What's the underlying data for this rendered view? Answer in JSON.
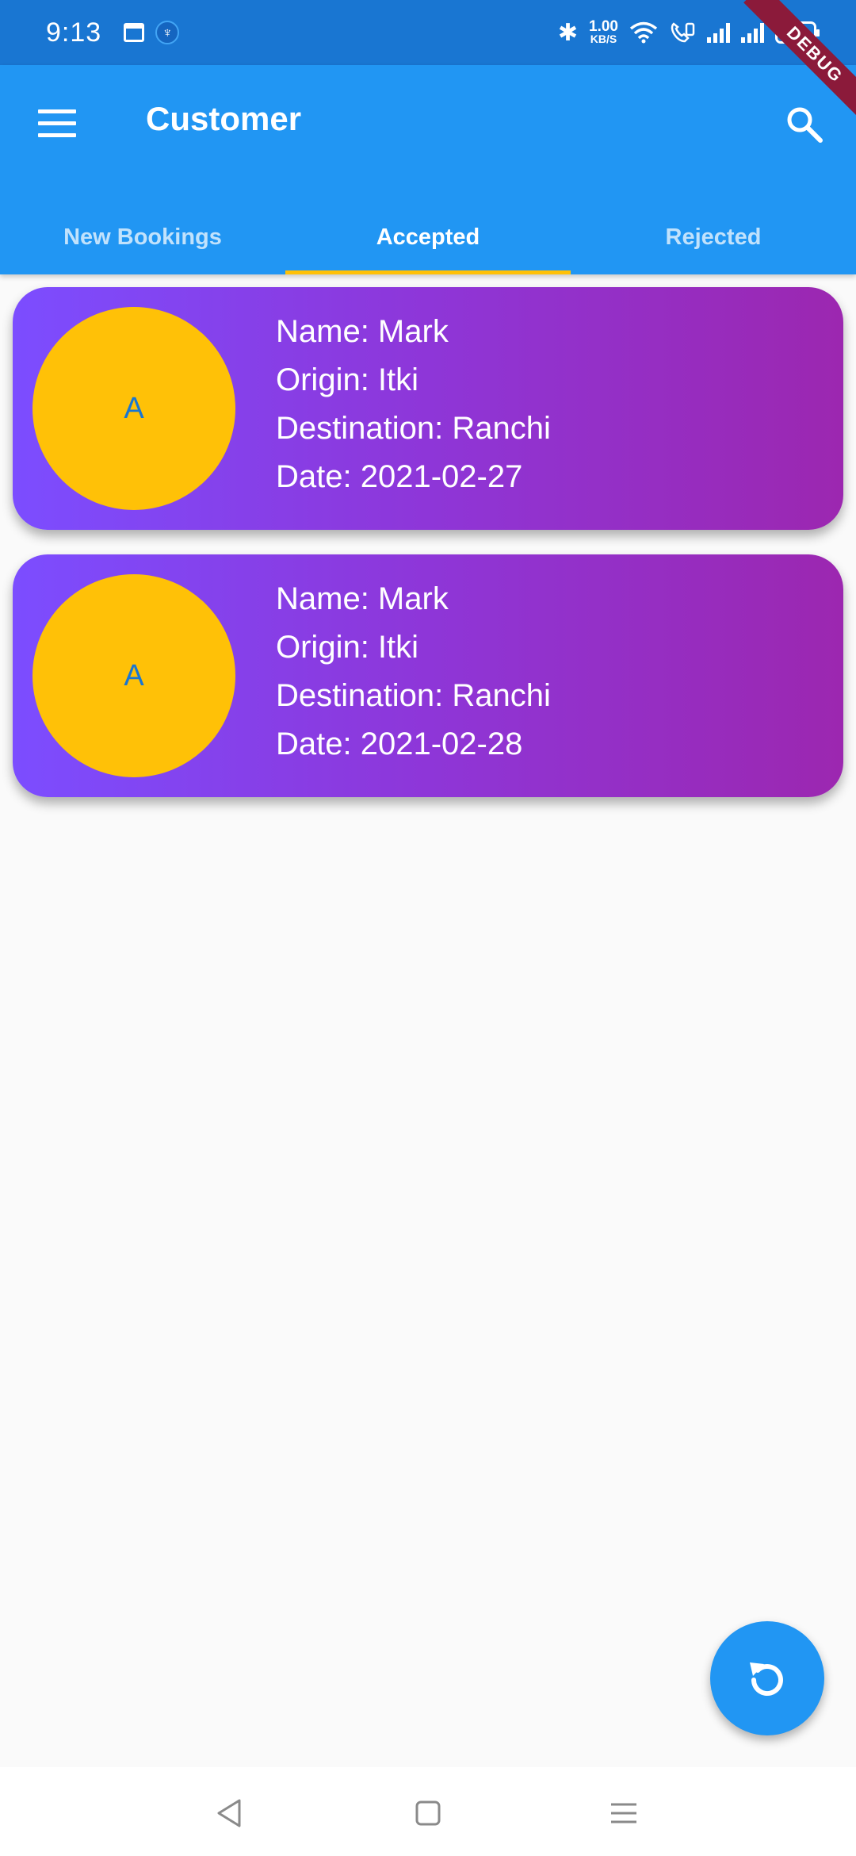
{
  "status_bar": {
    "time": "9:13",
    "speed_value": "1.00",
    "speed_unit": "KB/S",
    "battery": "100"
  },
  "debug_label": "DEBUG",
  "app_bar": {
    "title": "Customer",
    "menu_icon": "hamburger-menu-icon",
    "search_icon": "search-icon"
  },
  "tabs": [
    {
      "label": "New Bookings",
      "active": false
    },
    {
      "label": "Accepted",
      "active": true
    },
    {
      "label": "Rejected",
      "active": false
    }
  ],
  "bookings": [
    {
      "avatar": "A",
      "name": "Name: Mark",
      "origin": "Origin: Itki",
      "destination": "Destination: Ranchi",
      "date": "Date: 2021-02-27"
    },
    {
      "avatar": "A",
      "name": "Name: Mark",
      "origin": "Origin: Itki",
      "destination": "Destination: Ranchi",
      "date": "Date: 2021-02-28"
    }
  ],
  "fab_icon": "refresh-icon",
  "colors": {
    "status_bar": "#1976d2",
    "app_bar": "#2196f3",
    "tab_indicator": "#ffc107",
    "avatar": "#ffc107",
    "card_gradient_start": "#7c4dff",
    "card_gradient_end": "#9c27b0"
  }
}
